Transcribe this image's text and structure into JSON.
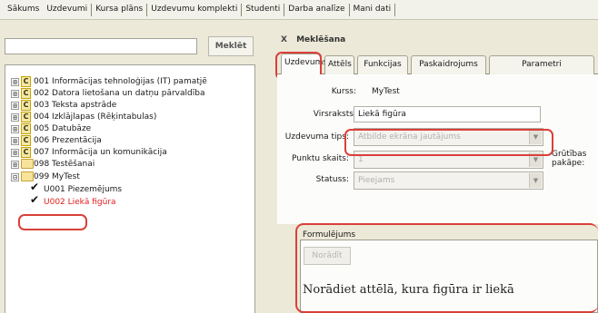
{
  "menu": {
    "items": [
      "Sākums",
      "Uzdevumi",
      "Kursa plāns",
      "Uzdevumu komplekti",
      "Studenti",
      "Darba analīze",
      "Mani dati"
    ]
  },
  "search": {
    "placeholder": "",
    "button_label": "Meklēt"
  },
  "tree": {
    "items": [
      {
        "code": "001",
        "label": "001 Informācijas tehnoloģijas (IT) pamatjē",
        "badge": "C"
      },
      {
        "code": "002",
        "label": "002 Datora lietošana un datņu pārvaldība",
        "badge": "C"
      },
      {
        "code": "003",
        "label": "003 Teksta apstrāde",
        "badge": "C"
      },
      {
        "code": "004",
        "label": "004 Izklājlapas (Rēķintabulas)",
        "badge": "C"
      },
      {
        "code": "005",
        "label": "005 Datubāze",
        "badge": "C"
      },
      {
        "code": "006",
        "label": "006 Prezentācija",
        "badge": "C"
      },
      {
        "code": "007",
        "label": "007 Informācija un komunikācija",
        "badge": "C"
      },
      {
        "code": "098",
        "label": "098 Testēšanai",
        "badge": ""
      },
      {
        "code": "099",
        "label": "099 MyTest",
        "badge": ""
      }
    ],
    "children": [
      {
        "label": "U001 Piezemējums",
        "active": false
      },
      {
        "label": "U002 Liekā figūra",
        "active": true
      }
    ],
    "expander_symbol": "⊞",
    "collapse_symbol": "⊟"
  },
  "right_panel": {
    "close_symbol": "X",
    "title": "Meklēšana"
  },
  "tabs": [
    "Uzdevums",
    "Attēls",
    "Funkcijas",
    "Paskaidrojums",
    "Parametri"
  ],
  "form": {
    "kurss_label": "Kurss:",
    "kurss_value": "MyTest",
    "virsraksts_label": "Virsraksts:",
    "virsraksts_value": "Liekā figūra",
    "tips_label": "Uzdevuma tips:",
    "tips_value": "Atbilde ekrāna jautājums",
    "skaits_label": "Punktu skaits:",
    "skaits_value": "1",
    "statuss_label": "Statuss:",
    "statuss_value": "Pieejams",
    "extra_text_1": "Grūtības",
    "extra_text_2": "pakāpe:"
  },
  "formulation": {
    "label": "Formulējums",
    "button_label": "Norādīt",
    "text": "Norādiet attēlā, kura figūra ir liekā"
  },
  "colors": {
    "highlight_red": "#d9403a",
    "active_child": "#e0201f"
  }
}
